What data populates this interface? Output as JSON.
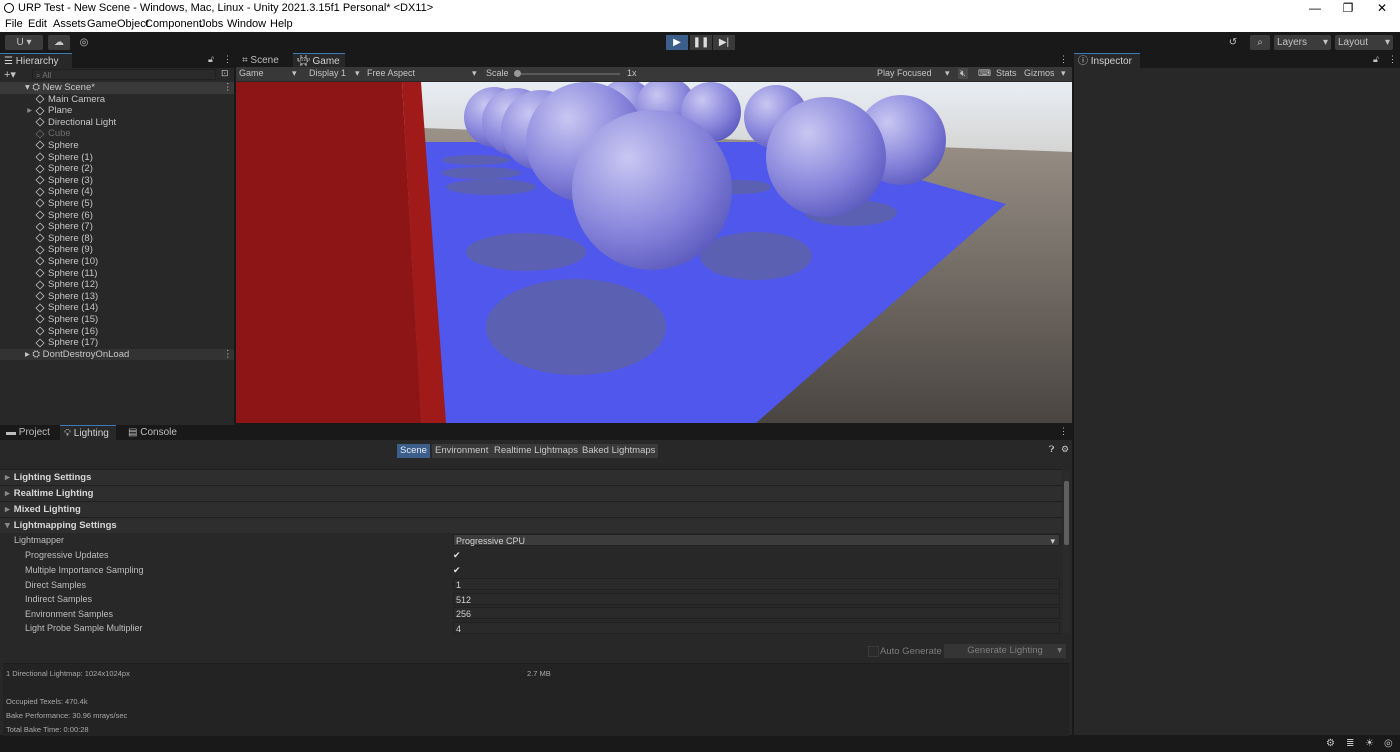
{
  "window": {
    "title": "URP Test - New Scene - Windows, Mac, Linux - Unity 2021.3.15f1 Personal* <DX11>",
    "controls": [
      "—",
      "❐",
      "✕"
    ]
  },
  "menu": [
    "File",
    "Edit",
    "Assets",
    "GameObject",
    "Component",
    "Jobs",
    "Window",
    "Help"
  ],
  "toolbar": {
    "account_label": "U ▾",
    "layers_label": "Layers",
    "layout_label": "Layout"
  },
  "hierarchy": {
    "tab_label": "Hierarchy",
    "search_placeholder": "All",
    "scene_name": "New Scene*",
    "items": [
      {
        "label": "Main Camera",
        "disabled": false
      },
      {
        "label": "Plane",
        "disabled": false,
        "has_children": true
      },
      {
        "label": "Directional Light",
        "disabled": false
      },
      {
        "label": "Cube",
        "disabled": true
      },
      {
        "label": "Sphere",
        "disabled": false
      },
      {
        "label": "Sphere (1)",
        "disabled": false
      },
      {
        "label": "Sphere (2)",
        "disabled": false
      },
      {
        "label": "Sphere (3)",
        "disabled": false
      },
      {
        "label": "Sphere (4)",
        "disabled": false
      },
      {
        "label": "Sphere (5)",
        "disabled": false
      },
      {
        "label": "Sphere (6)",
        "disabled": false
      },
      {
        "label": "Sphere (7)",
        "disabled": false
      },
      {
        "label": "Sphere (8)",
        "disabled": false
      },
      {
        "label": "Sphere (9)",
        "disabled": false
      },
      {
        "label": "Sphere (10)",
        "disabled": false
      },
      {
        "label": "Sphere (11)",
        "disabled": false
      },
      {
        "label": "Sphere (12)",
        "disabled": false
      },
      {
        "label": "Sphere (13)",
        "disabled": false
      },
      {
        "label": "Sphere (14)",
        "disabled": false
      },
      {
        "label": "Sphere (15)",
        "disabled": false
      },
      {
        "label": "Sphere (16)",
        "disabled": false
      },
      {
        "label": "Sphere (17)",
        "disabled": false
      }
    ],
    "dont_destroy": "DontDestroyOnLoad"
  },
  "view_tabs": {
    "scene": "Scene",
    "game": "Game"
  },
  "game_toolbar": {
    "mode": "Game",
    "display": "Display 1",
    "aspect": "Free Aspect",
    "scale_label": "Scale",
    "scale_value": "1x",
    "play_mode": "Play Focused",
    "stats": "Stats",
    "gizmos": "Gizmos"
  },
  "inspector": {
    "tab_label": "Inspector"
  },
  "bottom_tabs": {
    "project": "Project",
    "lighting": "Lighting",
    "console": "Console"
  },
  "lighting": {
    "subtabs": [
      "Scene",
      "Environment",
      "Realtime Lightmaps",
      "Baked Lightmaps"
    ],
    "active_subtab": "Scene",
    "sections": [
      "Lighting Settings",
      "Realtime Lighting",
      "Mixed Lighting",
      "Lightmapping Settings"
    ],
    "lightmapper_label": "Lightmapper",
    "lightmapper_value": "Progressive CPU",
    "progressive_updates_label": "Progressive Updates",
    "mis_label": "Multiple Importance Sampling",
    "direct_samples_label": "Direct Samples",
    "direct_samples_value": "1",
    "indirect_samples_label": "Indirect Samples",
    "indirect_samples_value": "512",
    "environment_samples_label": "Environment Samples",
    "environment_samples_value": "256",
    "probe_multiplier_label": "Light Probe Sample Multiplier",
    "probe_multiplier_value": "4",
    "auto_generate_label": "Auto Generate",
    "generate_button": "Generate Lighting",
    "stats": {
      "lightmap_info": "1 Directional Lightmap: 1024x1024px",
      "lightmap_size": "2.7 MB",
      "occupied_texels": "Occupied Texels: 470.4k",
      "bake_performance": "Bake Performance: 30.96 mrays/sec",
      "total_bake_time": "Total Bake Time: 0:00:28"
    }
  },
  "colors": {
    "accent": "#3a79bb",
    "panel": "#282828",
    "background": "#191919"
  }
}
